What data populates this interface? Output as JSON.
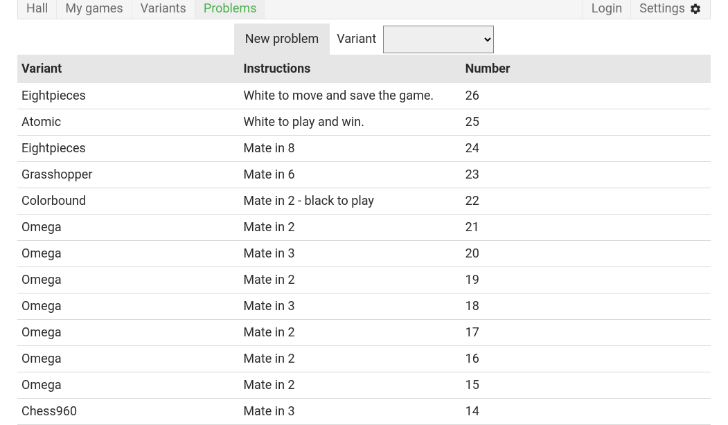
{
  "nav": {
    "hall": "Hall",
    "my_games": "My games",
    "variants": "Variants",
    "problems": "Problems",
    "login": "Login",
    "settings": "Settings"
  },
  "controls": {
    "new_problem_label": "New problem",
    "variant_label": "Variant",
    "variant_selected": ""
  },
  "table": {
    "headers": {
      "variant": "Variant",
      "instructions": "Instructions",
      "number": "Number"
    },
    "rows": [
      {
        "variant": "Eightpieces",
        "instructions": "White to move and save the game.",
        "number": "26"
      },
      {
        "variant": "Atomic",
        "instructions": "White to play and win.",
        "number": "25"
      },
      {
        "variant": "Eightpieces",
        "instructions": "Mate in 8",
        "number": "24"
      },
      {
        "variant": "Grasshopper",
        "instructions": "Mate in 6",
        "number": "23"
      },
      {
        "variant": "Colorbound",
        "instructions": "Mate in 2 - black to play",
        "number": "22"
      },
      {
        "variant": "Omega",
        "instructions": "Mate in 2",
        "number": "21"
      },
      {
        "variant": "Omega",
        "instructions": "Mate in 3",
        "number": "20"
      },
      {
        "variant": "Omega",
        "instructions": "Mate in 2",
        "number": "19"
      },
      {
        "variant": "Omega",
        "instructions": "Mate in 3",
        "number": "18"
      },
      {
        "variant": "Omega",
        "instructions": "Mate in 2",
        "number": "17"
      },
      {
        "variant": "Omega",
        "instructions": "Mate in 2",
        "number": "16"
      },
      {
        "variant": "Omega",
        "instructions": "Mate in 2",
        "number": "15"
      },
      {
        "variant": "Chess960",
        "instructions": "Mate in 3",
        "number": "14"
      }
    ]
  }
}
